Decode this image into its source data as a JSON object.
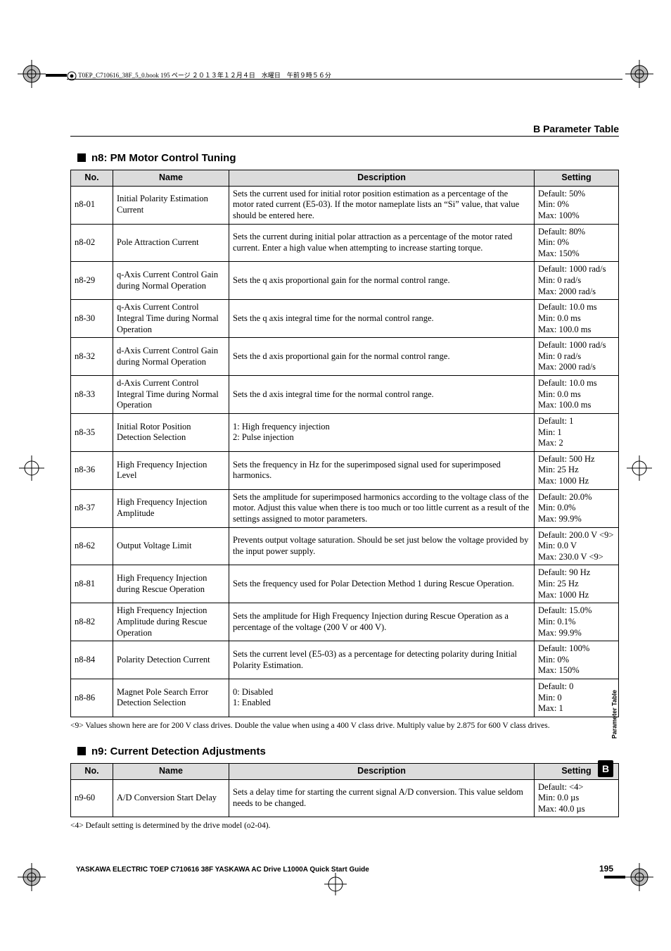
{
  "framemark": "T0EP_C710616_38F_5_0.book  195 ページ  ２０１３年１２月４日　水曜日　午前９時５６分",
  "header": {
    "title": "B  Parameter Table"
  },
  "section1": {
    "title": "n8: PM Motor Control Tuning"
  },
  "section2": {
    "title": "n9: Current Detection Adjustments"
  },
  "th": {
    "no": "No.",
    "name": "Name",
    "desc": "Description",
    "setting": "Setting"
  },
  "n8": [
    {
      "no": "n8-01",
      "name": "Initial Polarity Estimation Current",
      "desc": "Sets the current used for initial rotor position estimation as a percentage of the motor rated current (E5-03). If the motor nameplate lists an “Si” value, that value should be entered here.",
      "setting": "Default: 50%\nMin: 0%\nMax: 100%"
    },
    {
      "no": "n8-02",
      "name": "Pole Attraction Current",
      "desc": "Sets the current during initial polar attraction as a percentage of the motor rated current. Enter a high value when attempting to increase starting torque.",
      "setting": "Default: 80%\nMin: 0%\nMax: 150%"
    },
    {
      "no": "n8-29",
      "name": "q-Axis Current Control Gain during Normal Operation",
      "desc": "Sets the q axis proportional gain for the normal control range.",
      "setting": "Default: 1000 rad/s\nMin: 0 rad/s\nMax: 2000 rad/s"
    },
    {
      "no": "n8-30",
      "name": "q-Axis Current Control Integral Time during Normal Operation",
      "desc": "Sets the q axis integral time for the normal control range.",
      "setting": "Default: 10.0 ms\nMin: 0.0 ms\nMax: 100.0 ms"
    },
    {
      "no": "n8-32",
      "name": "d-Axis Current Control Gain during Normal Operation",
      "desc": "Sets the d axis proportional gain for the normal control range.",
      "setting": "Default: 1000 rad/s\nMin: 0 rad/s\nMax: 2000 rad/s"
    },
    {
      "no": "n8-33",
      "name": "d-Axis Current Control Integral Time during Normal Operation",
      "desc": "Sets the d axis integral time for the normal control range.",
      "setting": "Default: 10.0 ms\nMin: 0.0 ms\nMax: 100.0 ms"
    },
    {
      "no": "n8-35",
      "name": "Initial Rotor Position Detection Selection",
      "desc": "1: High frequency injection\n2: Pulse injection",
      "setting": "Default: 1\nMin: 1\nMax: 2"
    },
    {
      "no": "n8-36",
      "name": "High Frequency Injection Level",
      "desc": "Sets the frequency in Hz for the superimposed signal used for superimposed harmonics.",
      "setting": "Default: 500 Hz\nMin: 25 Hz\nMax: 1000 Hz"
    },
    {
      "no": "n8-37",
      "name": "High Frequency Injection Amplitude",
      "desc": "Sets the amplitude for superimposed harmonics according to the voltage class of the motor. Adjust this value when there is too much or too little current as a result of the settings assigned to motor parameters.",
      "setting": "Default: 20.0%\nMin: 0.0%\nMax: 99.9%"
    },
    {
      "no": "n8-62",
      "name": "Output Voltage Limit",
      "desc": "Prevents output voltage saturation. Should be set just below the voltage provided by the input power supply.",
      "setting": "Default: 200.0 V <9>\nMin: 0.0 V\nMax: 230.0 V <9>"
    },
    {
      "no": "n8-81",
      "name": "High Frequency Injection during Rescue Operation",
      "desc": "Sets the frequency used for Polar Detection Method 1 during Rescue Operation.",
      "setting": "Default: 90 Hz\nMin: 25 Hz\nMax: 1000 Hz"
    },
    {
      "no": "n8-82",
      "name": "High Frequency Injection Amplitude during Rescue Operation",
      "desc": "Sets the amplitude for High Frequency Injection during Rescue Operation as a percentage of the voltage (200 V or 400 V).",
      "setting": "Default: 15.0%\nMin: 0.1%\nMax: 99.9%"
    },
    {
      "no": "n8-84",
      "name": "Polarity Detection Current",
      "desc": "Sets the current level (E5-03) as a percentage for detecting polarity during Initial Polarity Estimation.",
      "setting": "Default: 100%\nMin: 0%\nMax: 150%"
    },
    {
      "no": "n8-86",
      "name": "Magnet Pole Search Error Detection Selection",
      "desc": "0: Disabled\n1: Enabled",
      "setting": "Default: 0\nMin: 0\nMax: 1"
    }
  ],
  "n9": [
    {
      "no": "n9-60",
      "name": "A/D Conversion Start Delay",
      "desc": "Sets a delay time for starting the current signal A/D conversion. This value seldom needs to be changed.",
      "setting": "Default: <4>\nMin: 0.0 µs\nMax: 40.0 µs"
    }
  ],
  "foot1": "<9> Values shown here are for 200 V class drives. Double the value when using a 400 V class drive. Multiply value by 2.875 for 600 V class drives.",
  "foot2": "<4> Default setting is determined by the drive model (o2-04).",
  "footer": {
    "left": "YASKAWA ELECTRIC TOEP C710616 38F YASKAWA AC Drive L1000A Quick Start Guide",
    "page": "195"
  },
  "side": {
    "label": "Parameter Table",
    "badge": "B"
  }
}
